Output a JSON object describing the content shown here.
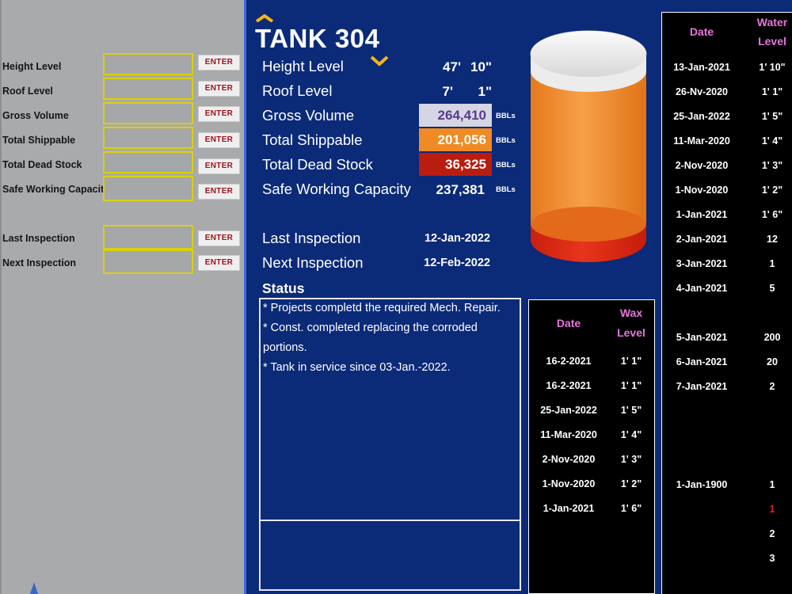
{
  "input_panel": {
    "fields": [
      {
        "label": "Height Level",
        "button": "ENTER"
      },
      {
        "label": "Roof Level",
        "button": "ENTER"
      },
      {
        "label": "Gross Volume",
        "button": "ENTER"
      },
      {
        "label": "Total Shippable",
        "button": "ENTER"
      },
      {
        "label": "Total Dead Stock",
        "button": "ENTER"
      },
      {
        "label": "Safe Working Capacity",
        "button": "ENTER"
      },
      {
        "label": "Last Inspection",
        "button": "ENTER"
      },
      {
        "label": "Next Inspection",
        "button": "ENTER"
      }
    ]
  },
  "tank": {
    "title": "TANK 304",
    "height_level": {
      "label": "Height Level",
      "feet": "47'",
      "inches": "10\""
    },
    "roof_level": {
      "label": "Roof Level",
      "feet": "7'",
      "inches": "1\""
    },
    "gross_volume": {
      "label": "Gross Volume",
      "value": "264,410",
      "unit": "BBLs"
    },
    "total_shippable": {
      "label": "Total Shippable",
      "value": "201,056",
      "unit": "BBLs"
    },
    "total_dead_stock": {
      "label": "Total Dead Stock",
      "value": "36,325",
      "unit": "BBLs"
    },
    "safe_working_capacity": {
      "label": "Safe Working Capacity",
      "value": "237,381",
      "unit": "BBLs"
    },
    "last_inspection": {
      "label": "Last Inspection",
      "value": "12-Jan-2022"
    },
    "next_inspection": {
      "label": "Next Inspection",
      "value": "12-Feb-2022"
    }
  },
  "status": {
    "heading": "Status",
    "lines": [
      "* Projects completd the required Mech. Repair.",
      "* Const. completed replacing the corroded",
      "portions.",
      "* Tank in service since 03-Jan.-2022."
    ]
  },
  "wax_table": {
    "headers": {
      "date": "Date",
      "level_1": "Wax",
      "level_2": "Level"
    },
    "rows": [
      {
        "date": "16-2-2021",
        "level": "1' 1\""
      },
      {
        "date": "16-2-2021",
        "level": "1' 1\""
      },
      {
        "date": "25-Jan-2022",
        "level": "1' 5\""
      },
      {
        "date": "11-Mar-2020",
        "level": "1' 4\""
      },
      {
        "date": "2-Nov-2020",
        "level": "1' 3\""
      },
      {
        "date": "1-Nov-2020",
        "level": "1' 2\""
      },
      {
        "date": "1-Jan-2021",
        "level": "1' 6\""
      }
    ]
  },
  "water_table": {
    "headers": {
      "date": "Date",
      "level_1": "Water",
      "level_2": "Level"
    },
    "rows": [
      {
        "date": "13-Jan-2021",
        "level": "1' 10\""
      },
      {
        "date": "26-Nv-2020",
        "level": "1' 1\""
      },
      {
        "date": "25-Jan-2022",
        "level": "1' 5\""
      },
      {
        "date": "11-Mar-2020",
        "level": "1' 4\""
      },
      {
        "date": "2-Nov-2020",
        "level": "1' 3\""
      },
      {
        "date": "1-Nov-2020",
        "level": "1' 2\""
      },
      {
        "date": "1-Jan-2021",
        "level": "1' 6\""
      },
      {
        "date": "2-Jan-2021",
        "level": "12"
      },
      {
        "date": "3-Jan-2021",
        "level": "1"
      },
      {
        "date": "4-Jan-2021",
        "level": "5"
      },
      {
        "date": "5-Jan-2021",
        "level": "200"
      },
      {
        "date": "6-Jan-2021",
        "level": "20"
      },
      {
        "date": "7-Jan-2021",
        "level": "2"
      },
      {
        "date": "1-Jan-1900",
        "level": "1"
      }
    ],
    "extra_levels": [
      "1",
      "2",
      "3"
    ]
  },
  "colors": {
    "background": "#0b2a78",
    "gross_volume_box": "#d5d6e4",
    "gross_volume_text": "#5b3a8c",
    "shippable_box": "#f08a24",
    "dead_stock_box": "#b91d10",
    "tank_body": "#f0922c",
    "tank_bottom": "#d82b16",
    "header_pink": "#e675e0",
    "highlight_red": "#e0202a"
  }
}
